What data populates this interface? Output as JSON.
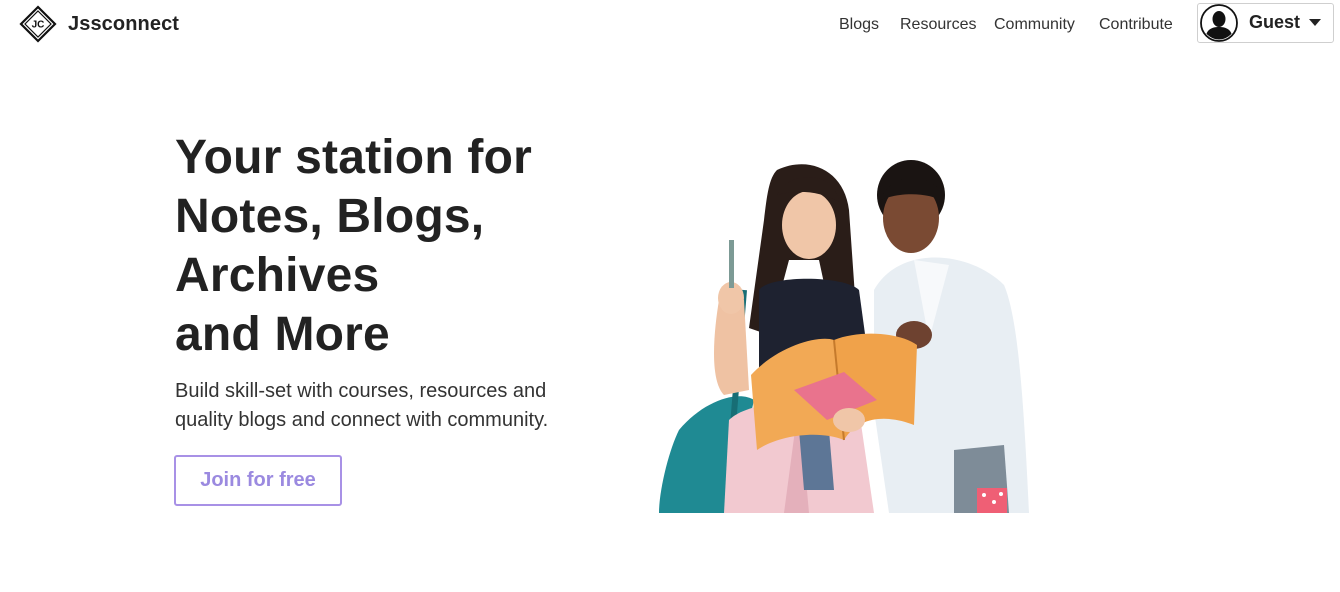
{
  "brand": {
    "logo_text": "JC",
    "name": "Jssconnect"
  },
  "nav": {
    "links": [
      {
        "label": "Blogs"
      },
      {
        "label": "Resources"
      },
      {
        "label": "Community"
      },
      {
        "label": "Contribute"
      }
    ],
    "user": {
      "label": "Guest",
      "avatar_icon": "user-silhouette-icon",
      "caret_icon": "caret-down-icon"
    }
  },
  "hero": {
    "heading_lines": [
      "Your station for",
      "Notes, Blogs,",
      "Archives",
      "and More"
    ],
    "subtitle_lines": [
      "Build skill-set with courses, resources and",
      "quality blogs and connect with community."
    ],
    "cta_label": "Join for free",
    "image_icon": "students-reading-illustration"
  },
  "colors": {
    "accent": "#9b8ae0",
    "accent_border": "#a891e6",
    "text": "#222222",
    "background": "#ffffff"
  }
}
